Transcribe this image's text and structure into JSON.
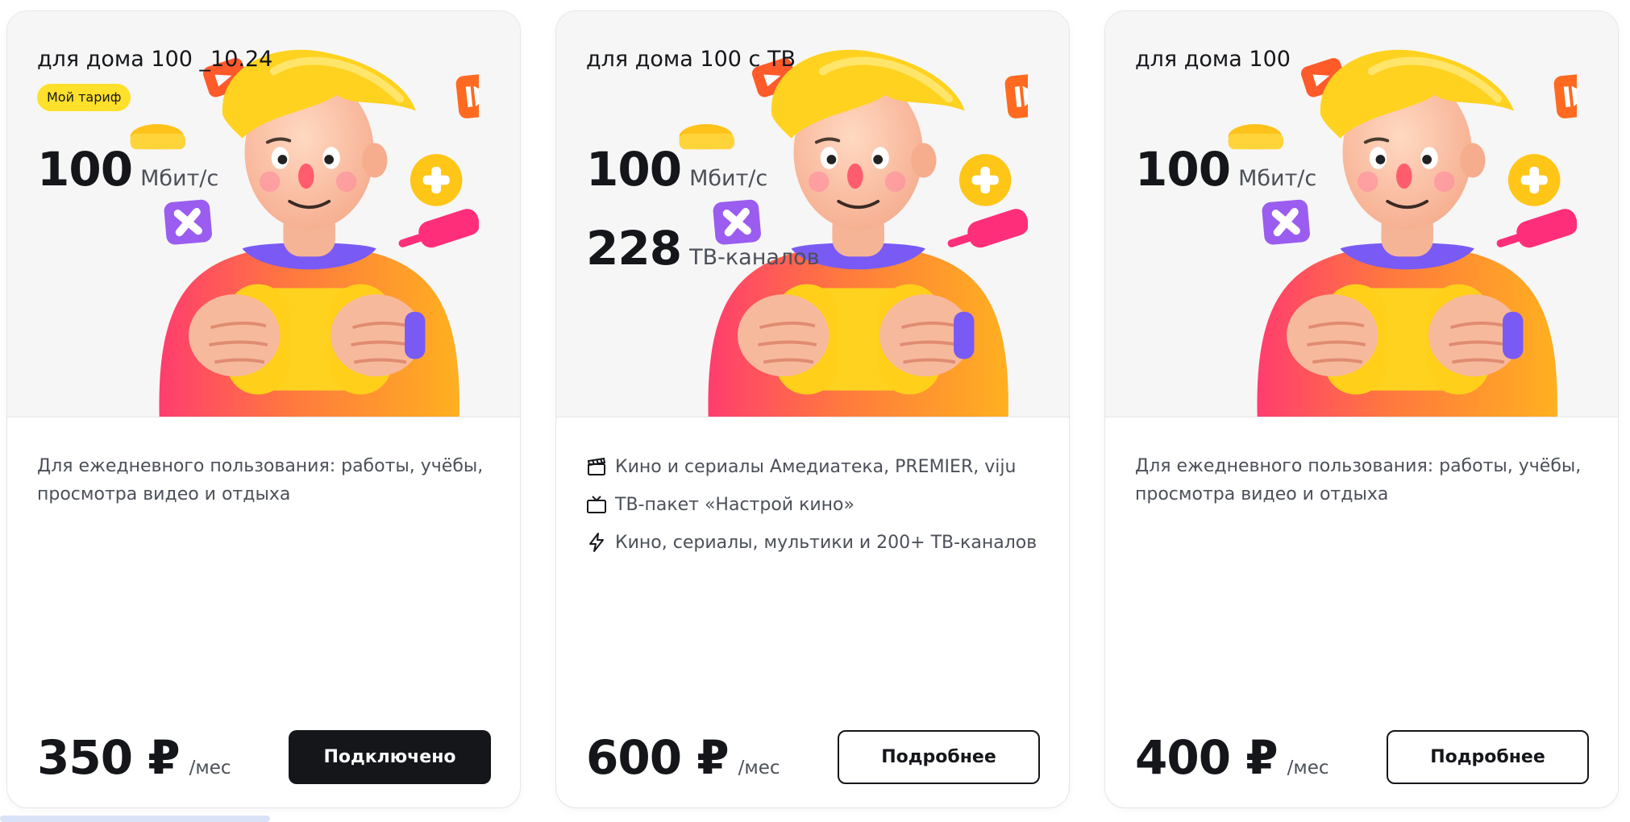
{
  "colors": {
    "badge": "#ffe02b",
    "primary_button_bg": "#14161a",
    "card_top_bg": "#f6f6f6",
    "text_secondary": "#4c5058"
  },
  "cards": [
    {
      "title": "для дома 100 _10.24",
      "badge": "Мой тариф",
      "speed": {
        "value": "100",
        "unit": "Мбит/с"
      },
      "description": "Для ежедневного пользования: работы, учёбы, просмотра видео и отдыха",
      "price": {
        "amount": "350 ₽",
        "period": "/мес"
      },
      "button": {
        "label": "Подключено",
        "style": "primary"
      }
    },
    {
      "title": "для дома 100 с ТВ",
      "speed": {
        "value": "100",
        "unit": "Мбит/с"
      },
      "channels": {
        "value": "228",
        "unit": "ТВ-каналов"
      },
      "features": [
        {
          "icon": "clapperboard-icon",
          "text": "Кино и сериалы Амедиатека, PREMIER, viju"
        },
        {
          "icon": "tv-icon",
          "text": "ТВ-пакет «Настрой кино»"
        },
        {
          "icon": "lightning-icon",
          "text": "Кино, сериалы, мультики и 200+ ТВ-каналов"
        }
      ],
      "price": {
        "amount": "600 ₽",
        "period": "/мес"
      },
      "button": {
        "label": "Подробнее",
        "style": "secondary"
      }
    },
    {
      "title": "для дома 100",
      "speed": {
        "value": "100",
        "unit": "Мбит/с"
      },
      "description": "Для ежедневного пользования: работы, учёбы, просмотра видео и отдыха",
      "price": {
        "amount": "400 ₽",
        "period": "/мес"
      },
      "button": {
        "label": "Подробнее",
        "style": "secondary"
      }
    }
  ]
}
